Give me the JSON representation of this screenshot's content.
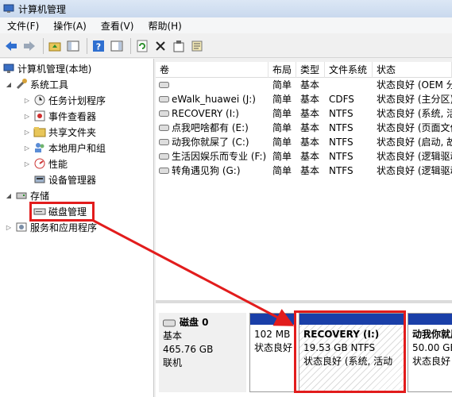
{
  "window": {
    "title": "计算机管理"
  },
  "menu": [
    "文件(F)",
    "操作(A)",
    "查看(V)",
    "帮助(H)"
  ],
  "toolbar": {
    "icons": [
      "back-arrow-icon",
      "forward-arrow-icon",
      "folder-up-icon",
      "show-hide-tree-icon",
      "help-icon",
      "properties-panel-icon",
      "refresh-icon",
      "delete-icon",
      "properties-icon",
      "export-icon"
    ]
  },
  "tree": {
    "root": "计算机管理(本地)",
    "system_tools": "系统工具",
    "task_scheduler": "任务计划程序",
    "event_viewer": "事件查看器",
    "shared_folders": "共享文件夹",
    "local_users": "本地用户和组",
    "performance": "性能",
    "device_manager": "设备管理器",
    "storage": "存储",
    "disk_management": "磁盘管理",
    "services_apps": "服务和应用程序"
  },
  "volumes": {
    "headers": [
      "卷",
      "布局",
      "类型",
      "文件系统",
      "状态"
    ],
    "rows": [
      {
        "name": "",
        "layout": "简单",
        "type": "基本",
        "fs": "",
        "status": "状态良好 (OEM 分"
      },
      {
        "name": "eWalk_huawei (J:)",
        "layout": "简单",
        "type": "基本",
        "fs": "CDFS",
        "status": "状态良好 (主分区)"
      },
      {
        "name": "RECOVERY (I:)",
        "layout": "简单",
        "type": "基本",
        "fs": "NTFS",
        "status": "状态良好 (系统, 活"
      },
      {
        "name": "点我吧啥都有 (E:)",
        "layout": "简单",
        "type": "基本",
        "fs": "NTFS",
        "status": "状态良好 (页面文件"
      },
      {
        "name": "动我你就屎了 (C:)",
        "layout": "简单",
        "type": "基本",
        "fs": "NTFS",
        "status": "状态良好 (启动, 故"
      },
      {
        "name": "生活因娱乐而专业 (F:)",
        "layout": "简单",
        "type": "基本",
        "fs": "NTFS",
        "status": "状态良好 (逻辑驱动"
      },
      {
        "name": "转角遇见狗 (G:)",
        "layout": "简单",
        "type": "基本",
        "fs": "NTFS",
        "status": "状态良好 (逻辑驱动"
      }
    ]
  },
  "disk": {
    "name": "磁盘 0",
    "type": "基本",
    "size": "465.76 GB",
    "state": "联机",
    "partitions": [
      {
        "size": "102 MB",
        "status": "状态良好"
      },
      {
        "label": "RECOVERY  (I:)",
        "size": "19.53 GB NTFS",
        "status": "状态良好 (系统, 活动"
      },
      {
        "label": "动我你就屎",
        "size": "50.00 GB",
        "status": "状态良好"
      }
    ]
  },
  "colors": {
    "annotation": "#e21c1c",
    "partition_bar": "#1a3fa8"
  }
}
